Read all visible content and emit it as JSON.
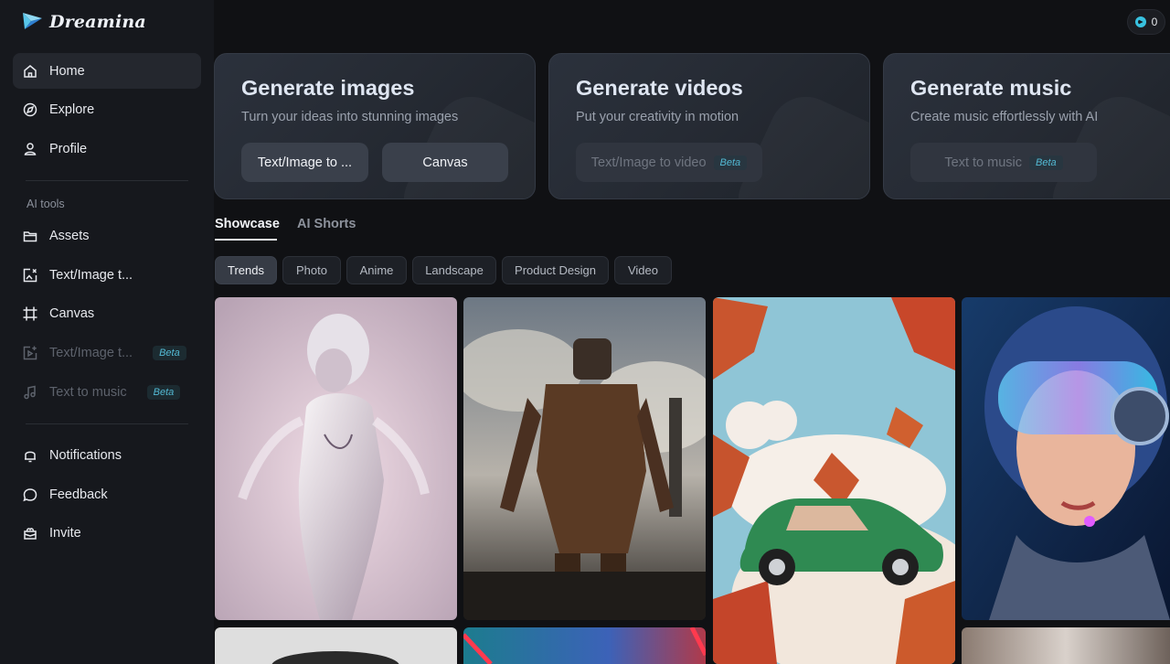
{
  "app": {
    "name": "Dreamina",
    "credits": "0"
  },
  "sidebar": {
    "main": [
      {
        "label": "Home",
        "icon": "home-icon",
        "active": true
      },
      {
        "label": "Explore",
        "icon": "compass-icon"
      },
      {
        "label": "Profile",
        "icon": "user-icon"
      }
    ],
    "section_label": "AI tools",
    "tools": [
      {
        "label": "Assets",
        "icon": "folder-icon"
      },
      {
        "label": "Text/Image t...",
        "icon": "image-edit-icon"
      },
      {
        "label": "Canvas",
        "icon": "canvas-icon"
      },
      {
        "label": "Text/Image t...",
        "icon": "video-icon",
        "badge": "Beta",
        "disabled": true
      },
      {
        "label": "Text to music",
        "icon": "music-icon",
        "badge": "Beta",
        "disabled": true
      }
    ],
    "bottom": [
      {
        "label": "Notifications",
        "icon": "bell-icon"
      },
      {
        "label": "Feedback",
        "icon": "feedback-icon"
      },
      {
        "label": "Invite",
        "icon": "gift-icon"
      }
    ]
  },
  "cards": [
    {
      "title": "Generate images",
      "subtitle": "Turn your ideas into stunning images",
      "buttons": [
        {
          "label": "Text/Image to ..."
        },
        {
          "label": "Canvas"
        }
      ]
    },
    {
      "title": "Generate videos",
      "subtitle": "Put your creativity in motion",
      "buttons": [
        {
          "label": "Text/Image to video",
          "badge": "Beta"
        }
      ]
    },
    {
      "title": "Generate music",
      "subtitle": "Create music effortlessly with AI",
      "buttons": [
        {
          "label": "Text to music",
          "badge": "Beta"
        }
      ]
    }
  ],
  "tabs": [
    {
      "label": "Showcase",
      "active": true
    },
    {
      "label": "AI Shorts"
    }
  ],
  "chips": [
    {
      "label": "Trends",
      "active": true
    },
    {
      "label": "Photo"
    },
    {
      "label": "Anime"
    },
    {
      "label": "Landscape"
    },
    {
      "label": "Product Design"
    },
    {
      "label": "Video"
    }
  ],
  "gallery": [
    {
      "name": "glass-figure-image"
    },
    {
      "name": "steampunk-robot-image"
    },
    {
      "name": "green-car-leaves-image"
    },
    {
      "name": "cyber-girl-image"
    },
    {
      "name": "dome-object-image"
    },
    {
      "name": "neon-frame-image"
    },
    {
      "name": "blurred-scene-image"
    }
  ],
  "colors": {
    "background": "#101114",
    "sidebar": "#16181d",
    "accent_beta": "#53b9d3",
    "credit": "#38c2e0"
  }
}
